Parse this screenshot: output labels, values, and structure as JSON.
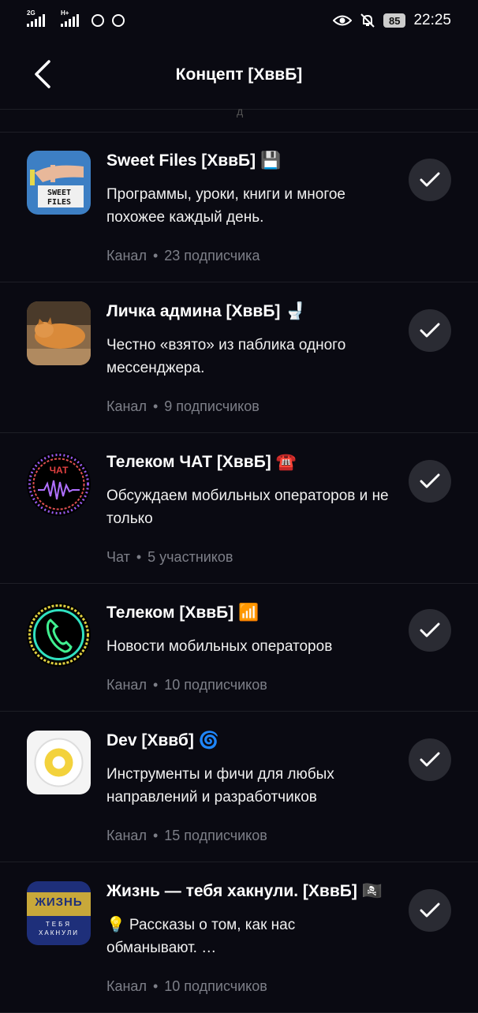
{
  "status_bar": {
    "net1": "2G",
    "net2": "H+",
    "battery": "85",
    "time": "22:25"
  },
  "header": {
    "title": "Концепт [ХввБ]"
  },
  "colors": {
    "background": "#0a0a12",
    "check_bg": "#2a2b33",
    "meta_text": "#7d7f88"
  },
  "channels": [
    {
      "title": "Sweet Files [ХввБ]",
      "emoji": "💾",
      "description": "Программы, уроки, книги и многое похожее каждый день.",
      "type": "Канал",
      "members": "23 подписчика",
      "avatar_icon": "sweet-files-logo",
      "avatar_text": "SWEET FILES"
    },
    {
      "title": "Личка админа [ХввБ]",
      "emoji": "🚽",
      "description": "Честно «взято» из паблика одного мессенджера.",
      "type": "Канал",
      "members": "9 подписчиков",
      "avatar_icon": "sleeping-cat-photo"
    },
    {
      "title": "Телеком ЧАТ [ХввБ]",
      "emoji": "☎️",
      "description": "Обсуждаем мобильных операторов и не только",
      "type": "Чат",
      "members": "5 участников",
      "avatar_icon": "chat-waveform-logo",
      "avatar_text": "ЧАТ"
    },
    {
      "title": "Телеком [ХввБ]",
      "emoji": "📶",
      "description": "Новости мобильных операторов",
      "type": "Канал",
      "members": "10 подписчиков",
      "avatar_icon": "neon-phone-logo"
    },
    {
      "title": "Dev [Хввб]",
      "emoji": "🌀",
      "description": "Инструменты и фичи для любых направлений и разработчиков",
      "type": "Канал",
      "members": "15 подписчиков",
      "avatar_icon": "dial-logo"
    },
    {
      "title": "Жизнь — тебя хакнули. [ХввБ]",
      "emoji": "🏴‍☠️",
      "description": "💡 Рассказы о том, как нас обманывают. …",
      "type": "Канал",
      "members": "10 подписчиков",
      "avatar_icon": "zhizn-logo",
      "avatar_text_1": "ЖИЗНЬ",
      "avatar_text_2": "ТЕБЯ",
      "avatar_text_3": "ХАКНУЛИ"
    }
  ]
}
